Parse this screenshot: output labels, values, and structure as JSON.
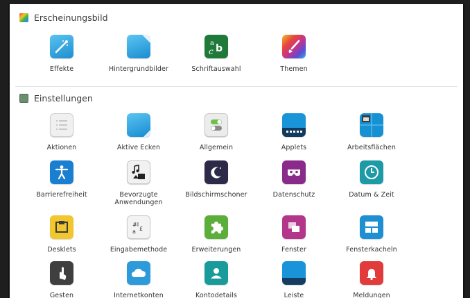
{
  "window": {
    "background": "#ffffff"
  },
  "sections": {
    "appearance": {
      "title": "Erscheinungsbild",
      "icon": "appearance-palette-icon"
    },
    "settings": {
      "title": "Einstellungen",
      "icon": "settings-panel-icon"
    }
  },
  "appearance_items": [
    {
      "label": "Effekte",
      "icon": "effects-wand-icon"
    },
    {
      "label": "Hintergrundbilder",
      "icon": "wallpaper-icon"
    },
    {
      "label": "Schriftauswahl",
      "icon": "font-selection-icon"
    },
    {
      "label": "Themen",
      "icon": "themes-brush-icon"
    }
  ],
  "settings_items": [
    {
      "label": "Aktionen",
      "icon": "actions-list-icon"
    },
    {
      "label": "Aktive Ecken",
      "icon": "hot-corners-icon"
    },
    {
      "label": "Allgemein",
      "icon": "general-toggle-icon"
    },
    {
      "label": "Applets",
      "icon": "applets-panel-icon"
    },
    {
      "label": "Arbeitsflächen",
      "icon": "workspaces-icon"
    },
    {
      "label": "Barrierefreiheit",
      "icon": "accessibility-icon"
    },
    {
      "label": "Bevorzugte\nAnwendungen",
      "icon": "preferred-apps-icon"
    },
    {
      "label": "Bildschirmschoner",
      "icon": "screensaver-moon-icon"
    },
    {
      "label": "Datenschutz",
      "icon": "privacy-mask-icon"
    },
    {
      "label": "Datum & Zeit",
      "icon": "clock-icon"
    },
    {
      "label": "Desklets",
      "icon": "desklets-icon"
    },
    {
      "label": "Eingabemethode",
      "icon": "input-method-icon"
    },
    {
      "label": "Erweiterungen",
      "icon": "extensions-puzzle-icon"
    },
    {
      "label": "Fenster",
      "icon": "windows-icon"
    },
    {
      "label": "Fensterkacheln",
      "icon": "window-tiling-icon"
    },
    {
      "label": "Gesten",
      "icon": "gestures-hand-icon"
    },
    {
      "label": "Internetkonten",
      "icon": "online-accounts-cloud-icon"
    },
    {
      "label": "Kontodetails",
      "icon": "account-details-icon"
    },
    {
      "label": "Leiste",
      "icon": "panel-bar-icon"
    },
    {
      "label": "Meldungen",
      "icon": "notifications-bell-icon"
    }
  ]
}
